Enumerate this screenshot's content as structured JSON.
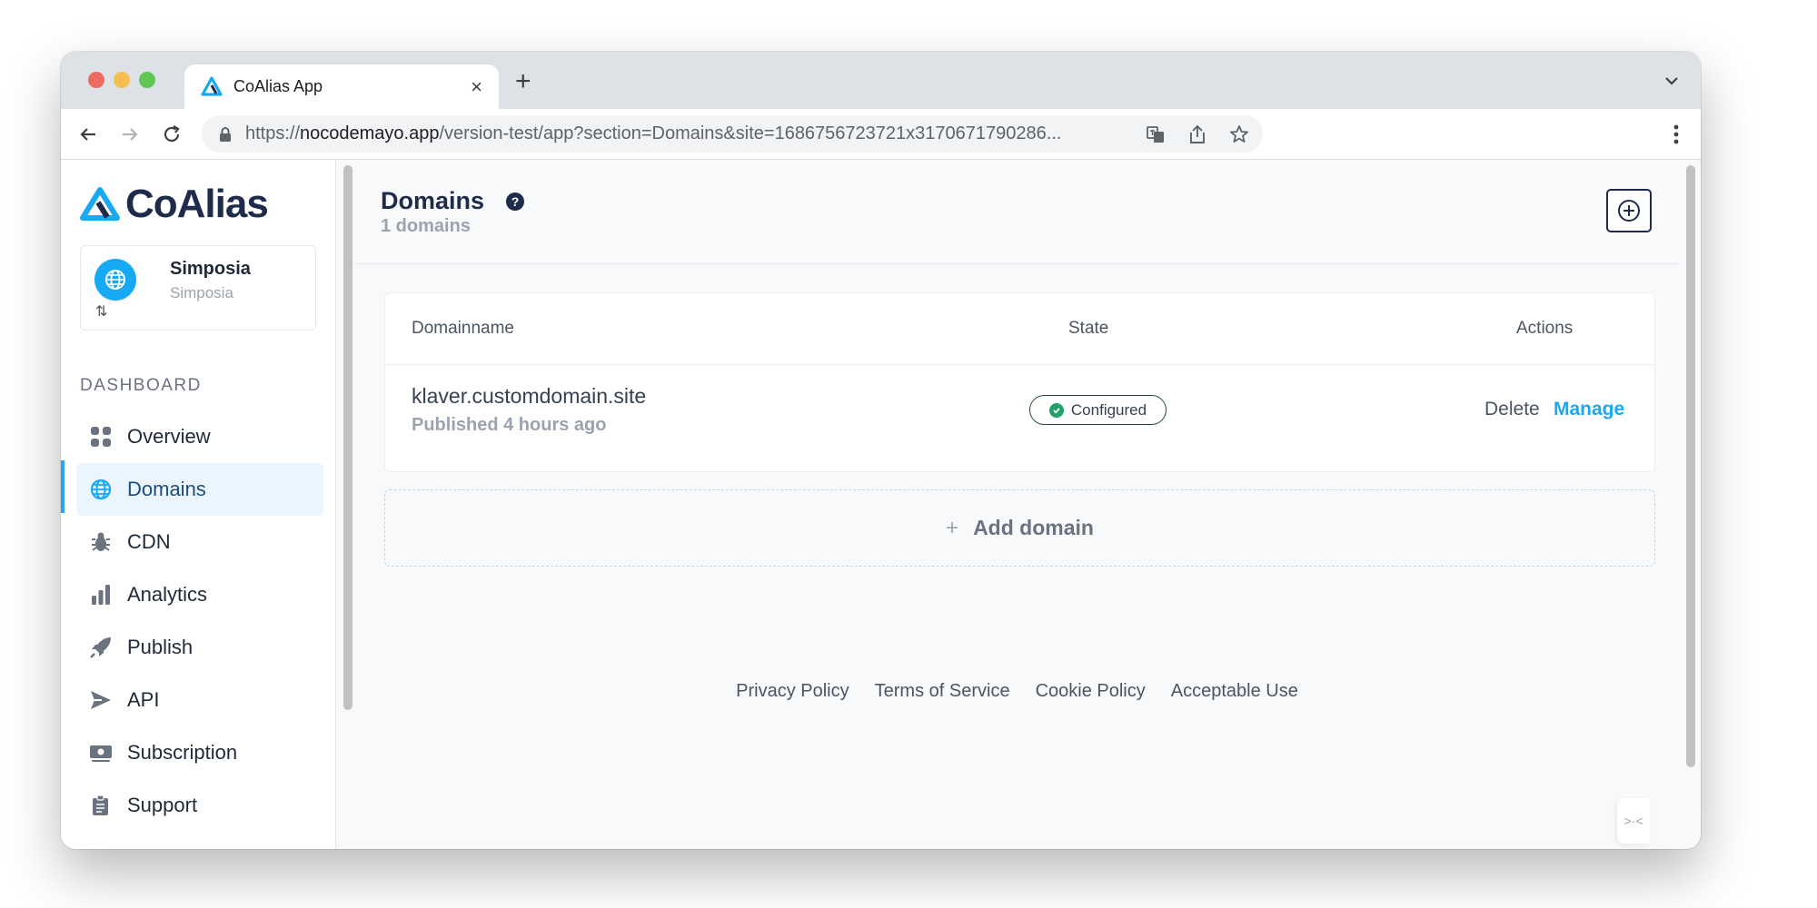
{
  "browser": {
    "tab_title": "CoAlias App",
    "tab_close": "×",
    "new_tab": "+",
    "url_origin": "https://",
    "url_host": "nocodemayo.app",
    "url_path": "/version-test/app?section=Domains&site=1686756723721x3170671790286..."
  },
  "sidebar": {
    "logo_text": "CoAlias",
    "site_name": "Simposia",
    "site_subtitle": "Simposia",
    "section_label": "DASHBOARD",
    "items": [
      {
        "label": "Overview",
        "icon": "grid-icon"
      },
      {
        "label": "Domains",
        "icon": "globe-icon",
        "active": true
      },
      {
        "label": "CDN",
        "icon": "bug-icon"
      },
      {
        "label": "Analytics",
        "icon": "bar-chart-icon"
      },
      {
        "label": "Publish",
        "icon": "rocket-icon"
      },
      {
        "label": "API",
        "icon": "send-icon"
      },
      {
        "label": "Subscription",
        "icon": "money-icon"
      },
      {
        "label": "Support",
        "icon": "clipboard-icon"
      }
    ]
  },
  "main": {
    "title": "Domains",
    "count": "1 domains",
    "table": {
      "headers": [
        "Domainname",
        "State",
        "Actions"
      ],
      "rows": [
        {
          "domain": "klaver.customdomain.site",
          "published": "Published 4 hours ago",
          "state": "Configured",
          "delete": "Delete",
          "manage": "Manage"
        }
      ]
    },
    "add_domain": "Add domain"
  },
  "footer": {
    "links": [
      "Privacy Policy",
      "Terms of Service",
      "Cookie Policy",
      "Acceptable Use"
    ]
  },
  "colors": {
    "accent": "#18a9f5",
    "navy": "#1e2b4a",
    "active_bg": "#eaf5fd",
    "success": "#22a06b"
  }
}
